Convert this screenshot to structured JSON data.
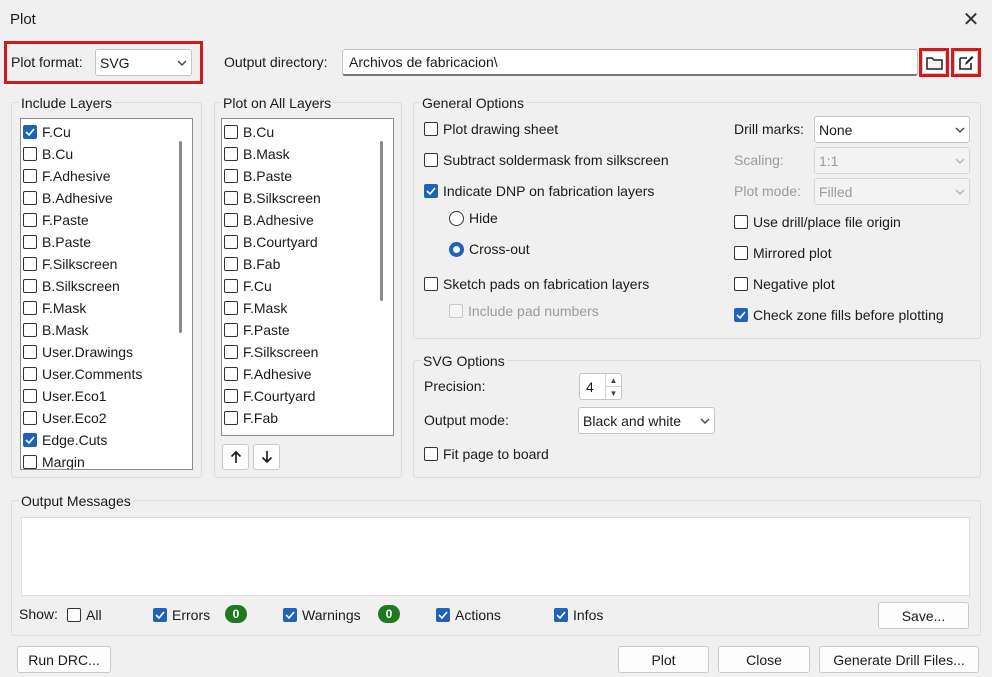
{
  "window": {
    "title": "Plot"
  },
  "plot_format": {
    "label": "Plot format:",
    "value": "SVG"
  },
  "output_directory": {
    "label": "Output directory:",
    "value": "Archivos de fabricacion\\"
  },
  "include_layers": {
    "label": "Include Layers",
    "items": [
      {
        "label": "F.Cu",
        "checked": true
      },
      {
        "label": "B.Cu",
        "checked": false
      },
      {
        "label": "F.Adhesive",
        "checked": false
      },
      {
        "label": "B.Adhesive",
        "checked": false
      },
      {
        "label": "F.Paste",
        "checked": false
      },
      {
        "label": "B.Paste",
        "checked": false
      },
      {
        "label": "F.Silkscreen",
        "checked": false
      },
      {
        "label": "B.Silkscreen",
        "checked": false
      },
      {
        "label": "F.Mask",
        "checked": false
      },
      {
        "label": "B.Mask",
        "checked": false
      },
      {
        "label": "User.Drawings",
        "checked": false
      },
      {
        "label": "User.Comments",
        "checked": false
      },
      {
        "label": "User.Eco1",
        "checked": false
      },
      {
        "label": "User.Eco2",
        "checked": false
      },
      {
        "label": "Edge.Cuts",
        "checked": true
      },
      {
        "label": "Margin",
        "checked": false
      }
    ]
  },
  "plot_all_layers": {
    "label": "Plot on All Layers",
    "items": [
      {
        "label": "B.Cu",
        "checked": false
      },
      {
        "label": "B.Mask",
        "checked": false
      },
      {
        "label": "B.Paste",
        "checked": false
      },
      {
        "label": "B.Silkscreen",
        "checked": false
      },
      {
        "label": "B.Adhesive",
        "checked": false
      },
      {
        "label": "B.Courtyard",
        "checked": false
      },
      {
        "label": "B.Fab",
        "checked": false
      },
      {
        "label": "F.Cu",
        "checked": false
      },
      {
        "label": "F.Mask",
        "checked": false
      },
      {
        "label": "F.Paste",
        "checked": false
      },
      {
        "label": "F.Silkscreen",
        "checked": false
      },
      {
        "label": "F.Adhesive",
        "checked": false
      },
      {
        "label": "F.Courtyard",
        "checked": false
      },
      {
        "label": "F.Fab",
        "checked": false
      }
    ],
    "up_icon": "arrow-up-icon",
    "down_icon": "arrow-down-icon"
  },
  "general_options": {
    "label": "General Options",
    "plot_drawing_sheet": "Plot drawing sheet",
    "subtract_soldermask": "Subtract soldermask from silkscreen",
    "indicate_dnp": "Indicate DNP on fabrication layers",
    "hide": "Hide",
    "cross_out": "Cross-out",
    "sketch_pads": "Sketch pads on fabrication layers",
    "include_pad_numbers": "Include pad numbers",
    "drill_marks_label": "Drill marks:",
    "drill_marks_value": "None",
    "scaling_label": "Scaling:",
    "scaling_value": "1:1",
    "plot_mode_label": "Plot mode:",
    "plot_mode_value": "Filled",
    "use_drill_origin": "Use drill/place file origin",
    "mirrored_plot": "Mirrored plot",
    "negative_plot": "Negative plot",
    "check_zone_fills": "Check zone fills before plotting"
  },
  "svg_options": {
    "label": "SVG Options",
    "precision_label": "Precision:",
    "precision_value": "4",
    "output_mode_label": "Output mode:",
    "output_mode_value": "Black and white",
    "fit_page": "Fit page to board"
  },
  "output_messages": {
    "label": "Output Messages",
    "show_label": "Show:",
    "all": "All",
    "errors": "Errors",
    "errors_count": "0",
    "warnings": "Warnings",
    "warnings_count": "0",
    "actions": "Actions",
    "infos": "Infos",
    "save": "Save..."
  },
  "footer": {
    "run_drc": "Run DRC...",
    "plot": "Plot",
    "close": "Close",
    "generate_drill": "Generate Drill Files..."
  },
  "colors": {
    "accent": "#1e63b8",
    "highlight": "#d11a1a",
    "badge": "#1f7a1f"
  }
}
